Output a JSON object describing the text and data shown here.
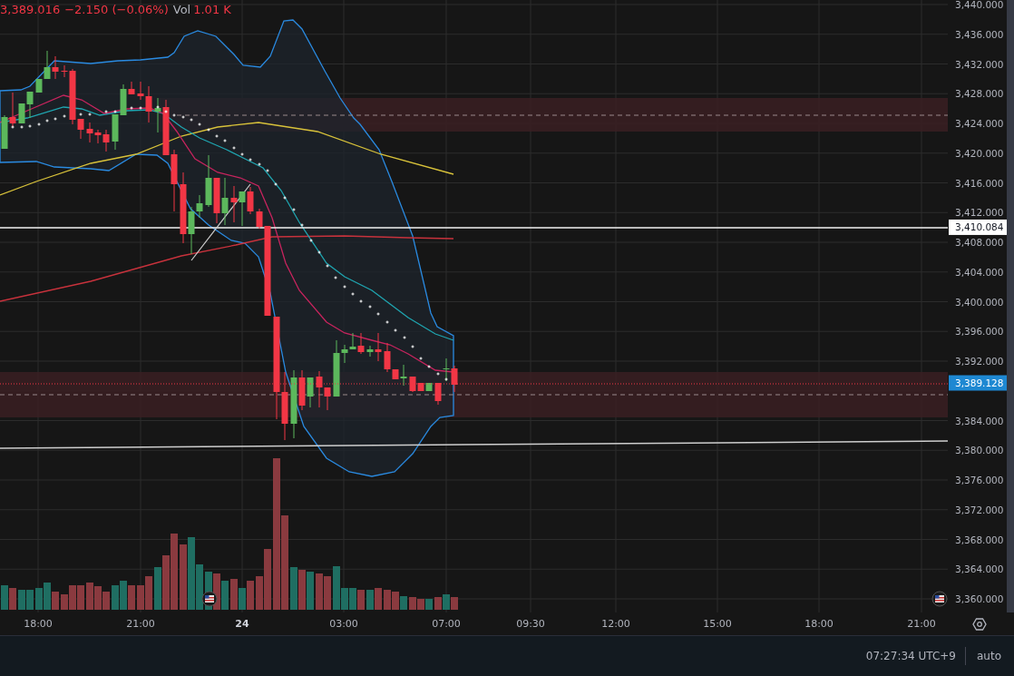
{
  "legend": {
    "last": "3,389.016",
    "change": "−2.150 (−0.06%)",
    "volume_label": "Vol",
    "volume_value": "1.01 K"
  },
  "price_axis": {
    "labels": [
      "3,440.000",
      "3,436.000",
      "3,432.000",
      "3,428.000",
      "3,424.000",
      "3,420.000",
      "3,416.000",
      "3,412.000",
      "3,408.000",
      "3,404.000",
      "3,400.000",
      "3,396.000",
      "3,392.000",
      "3,384.000",
      "3,380.000",
      "3,376.000",
      "3,372.000",
      "3,368.000",
      "3,364.000",
      "3,360.000"
    ]
  },
  "price_tags": [
    {
      "value": "3,410.084",
      "kind": "line"
    },
    {
      "value": "3,389.128",
      "kind": "last"
    }
  ],
  "time_axis": {
    "labels": [
      {
        "text": "18:00",
        "bold": false
      },
      {
        "text": "21:00",
        "bold": false
      },
      {
        "text": "24",
        "bold": true
      },
      {
        "text": "03:00",
        "bold": false
      },
      {
        "text": "07:00",
        "bold": false
      },
      {
        "text": "09:30",
        "bold": false
      },
      {
        "text": "12:00",
        "bold": false
      },
      {
        "text": "15:00",
        "bold": false
      },
      {
        "text": "18:00",
        "bold": false
      },
      {
        "text": "21:00",
        "bold": false
      }
    ]
  },
  "status_bar": {
    "time": "07:27:34 UTC+9",
    "scale": "auto"
  }
}
